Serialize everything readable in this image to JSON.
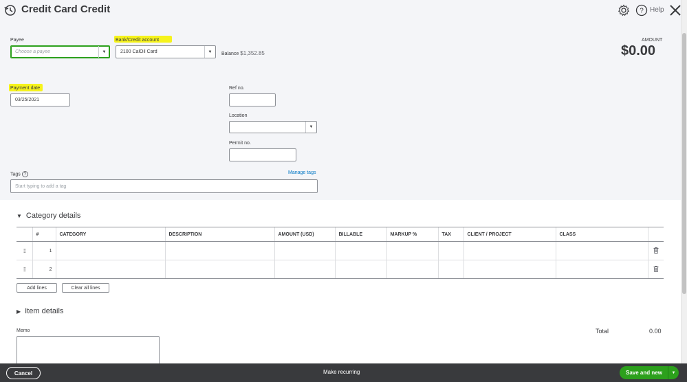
{
  "header": {
    "title": "Credit Card Credit",
    "help_label": "Help",
    "history_icon": "history-icon",
    "settings_icon": "gear-icon",
    "help_icon": "help-icon",
    "close_icon": "close-icon"
  },
  "form": {
    "payee": {
      "label": "Payee",
      "placeholder": "Choose a payee"
    },
    "bank_account": {
      "label": "Bank/Credit account",
      "value": "2100 CalOil Card"
    },
    "balance": {
      "label": "Balance",
      "value": "$1,352.85"
    },
    "amount": {
      "label": "AMOUNT",
      "value": "$0.00"
    },
    "payment_date": {
      "label": "Payment date",
      "value": "03/25/2021"
    },
    "ref_no": {
      "label": "Ref no.",
      "value": ""
    },
    "location": {
      "label": "Location",
      "value": ""
    },
    "permit_no": {
      "label": "Permit no.",
      "value": ""
    },
    "tags": {
      "label": "Tags",
      "placeholder": "Start typing to add a tag",
      "manage_label": "Manage tags"
    }
  },
  "category_details": {
    "title": "Category details",
    "columns": [
      "#",
      "CATEGORY",
      "DESCRIPTION",
      "AMOUNT (USD)",
      "BILLABLE",
      "MARKUP %",
      "TAX",
      "CLIENT / PROJECT",
      "CLASS"
    ],
    "rows": [
      {
        "num": "1"
      },
      {
        "num": "2"
      }
    ],
    "add_lines": "Add lines",
    "clear_all": "Clear all lines"
  },
  "item_details": {
    "title": "Item details"
  },
  "memo": {
    "label": "Memo"
  },
  "total": {
    "label": "Total",
    "value": "0.00"
  },
  "footer": {
    "cancel": "Cancel",
    "make_recurring": "Make recurring",
    "save": "Save and new"
  },
  "colors": {
    "accent_green": "#2ca01c",
    "highlight_yellow": "#f6f31c",
    "link_blue": "#0077c5",
    "footer_bg": "#393a3d"
  }
}
